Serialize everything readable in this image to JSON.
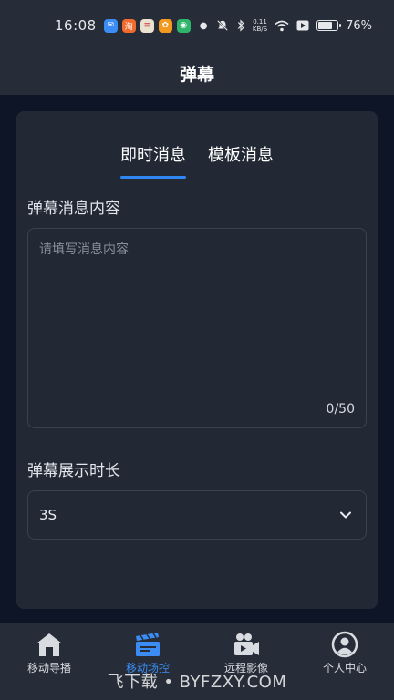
{
  "status_bar": {
    "time": "16:08",
    "net_speed_value": "0.11",
    "net_speed_unit": "KB/S",
    "battery": "76%",
    "battery_level": 0.76,
    "app_icons": [
      {
        "name": "app-icon-1",
        "color": "#3b8df5",
        "glyph": "✉"
      },
      {
        "name": "app-icon-2",
        "color": "#f26b2e",
        "glyph": "淘"
      },
      {
        "name": "app-icon-3",
        "color": "#e9e2d0",
        "glyph": "≡"
      },
      {
        "name": "app-icon-4",
        "color": "#f39a1e",
        "glyph": "✿"
      },
      {
        "name": "app-icon-5",
        "color": "#2fb56a",
        "glyph": "◉"
      }
    ]
  },
  "header": {
    "title": "弹幕"
  },
  "tabs": [
    {
      "label": "即时消息",
      "active": true
    },
    {
      "label": "模板消息",
      "active": false
    }
  ],
  "message_section": {
    "label": "弹幕消息内容",
    "placeholder": "请填写消息内容",
    "value": "",
    "char_count": "0/50"
  },
  "duration_section": {
    "label": "弹幕展示时长",
    "selected": "3S"
  },
  "bottom_nav": {
    "items": [
      {
        "label": "移动导播",
        "icon": "home-icon",
        "active": false
      },
      {
        "label": "移动场控",
        "icon": "clapperboard-icon",
        "active": true
      },
      {
        "label": "远程影像",
        "icon": "video-camera-icon",
        "active": false
      },
      {
        "label": "个人中心",
        "icon": "user-profile-icon",
        "active": false
      }
    ]
  },
  "watermark": "飞下载 • BYFZXY.COM",
  "colors": {
    "accent": "#2f86f0",
    "background": "#0e1526",
    "panel": "#222934",
    "bar": "#262d38"
  }
}
